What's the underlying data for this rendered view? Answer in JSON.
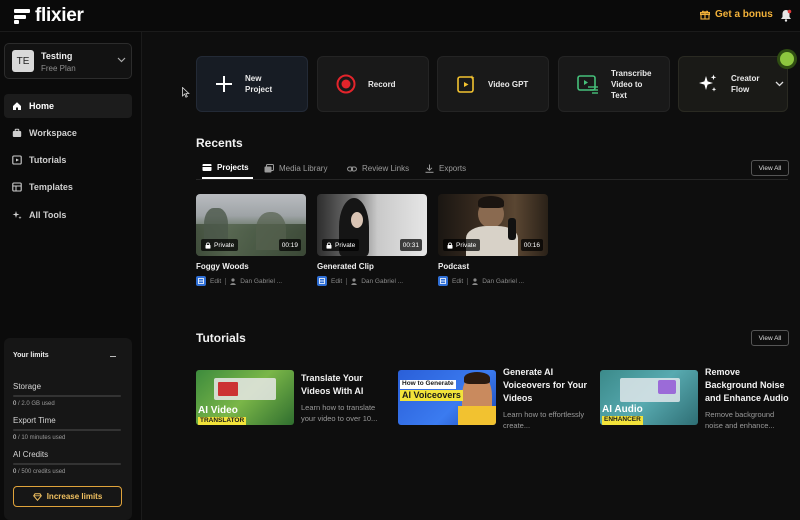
{
  "brand": {
    "name": "flixier"
  },
  "header": {
    "bonus_label": "Get a bonus"
  },
  "workspace": {
    "avatar": "TE",
    "name": "Testing",
    "plan": "Free Plan"
  },
  "nav": [
    {
      "label": "Home",
      "icon": "home-icon",
      "active": true
    },
    {
      "label": "Workspace",
      "icon": "briefcase-icon"
    },
    {
      "label": "Tutorials",
      "icon": "play-square-icon"
    },
    {
      "label": "Templates",
      "icon": "template-icon"
    },
    {
      "label": "All Tools",
      "icon": "sparkle-icon"
    }
  ],
  "limits": {
    "title": "Your limits",
    "items": [
      {
        "label": "Storage",
        "used": "0",
        "rest": " / 2.0 GB used",
        "fraction": 0
      },
      {
        "label": "Export Time",
        "used": "0",
        "rest": " / 10 minutes used",
        "fraction": 0
      },
      {
        "label": "AI Credits",
        "used": "0",
        "rest": " / 500 credits used",
        "fraction": 0
      }
    ],
    "button": "Increase limits"
  },
  "quick_actions": [
    {
      "label": "New Project",
      "icon": "plus-icon"
    },
    {
      "label": "Record",
      "icon": "record-icon"
    },
    {
      "label": "Video GPT",
      "icon": "video-gpt-icon"
    },
    {
      "label": "Transcribe Video to Text",
      "icon": "transcribe-icon"
    },
    {
      "label": "Creator Flow",
      "icon": "sparkles-icon"
    }
  ],
  "recents": {
    "title": "Recents",
    "tabs": [
      "Projects",
      "Media Library",
      "Review Links",
      "Exports"
    ],
    "view_all": "View All",
    "projects": [
      {
        "title": "Foggy Woods",
        "privacy": "Private",
        "duration": "00:19",
        "edit": "Edit",
        "author": "Dan Gabriel ..."
      },
      {
        "title": "Generated Clip",
        "privacy": "Private",
        "duration": "00:31",
        "edit": "Edit",
        "author": "Dan Gabriel ..."
      },
      {
        "title": "Podcast",
        "privacy": "Private",
        "duration": "00:16",
        "edit": "Edit",
        "author": "Dan Gabriel ..."
      }
    ]
  },
  "tutorials": {
    "title": "Tutorials",
    "view_all": "View All",
    "items": [
      {
        "title": "Translate Your Videos With AI",
        "desc": "Learn how to translate your video to over 10...",
        "thumb_line1": "AI Video",
        "thumb_line2": "TRANSLATOR"
      },
      {
        "title": "Generate AI Voiceovers for Your Videos",
        "desc": "Learn how to effortlessly create...",
        "thumb_line1": "How to Generate",
        "thumb_line2": "AI Voiceovers"
      },
      {
        "title": "Remove Background Noise and Enhance Audio",
        "desc": "Remove background noise and enhance...",
        "thumb_line1": "AI Audio",
        "thumb_line2": "ENHANCER"
      }
    ]
  },
  "colors": {
    "accent": "#f3b23a",
    "brand_blue": "#2f6fd6",
    "record_red": "#e3242b",
    "gpt_yellow": "#f2c230",
    "transcribe_green": "#45c07a"
  }
}
